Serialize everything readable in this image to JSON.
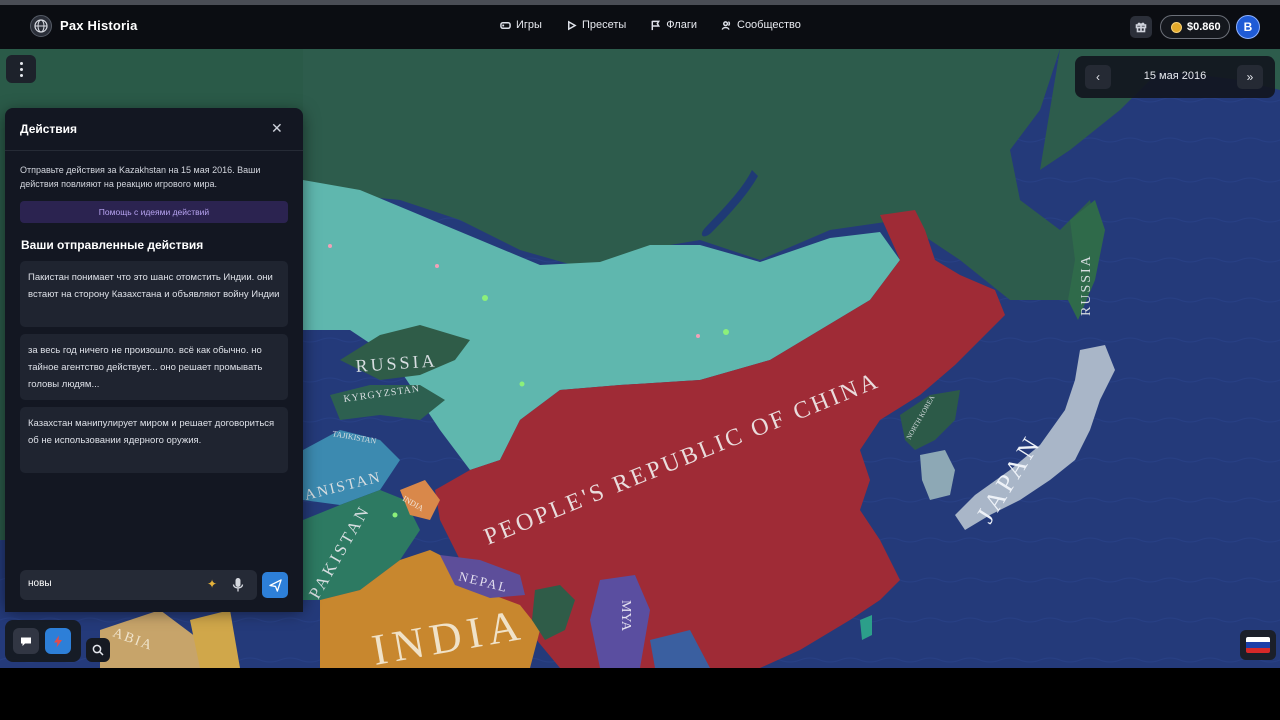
{
  "header": {
    "brand": "Pax Historia",
    "nav": [
      {
        "label": "Игры",
        "icon": "gamepad-icon"
      },
      {
        "label": "Пресеты",
        "icon": "play-icon"
      },
      {
        "label": "Флаги",
        "icon": "flag-icon"
      },
      {
        "label": "Сообщество",
        "icon": "users-icon"
      }
    ],
    "balance": "$0.860",
    "avatar_letter": "B"
  },
  "date_widget": {
    "date": "15 мая 2016",
    "prev_icon": "chevron-left-icon",
    "next_icon": "double-chevron-right-icon"
  },
  "actions_panel": {
    "title": "Действия",
    "close_label": "✕",
    "description": "Отправьте действия за Kazakhstan на 15 мая 2016. Ваши действия повлияют на реакцию игрового мира.",
    "help_button": "Помощь с идеями действий",
    "sent_title": "Ваши отправленные действия",
    "actions": [
      "Пакистан понимает что это шанс отомстить Индии. они встают на сторону Казахстана и объявляют войну Индии",
      "за весь год ничего не произошло. всё как обычно. но тайное агентство действует... оно решает промывать головы людям...",
      "Казахстан манипулирует миром и решает договориться об не использовании ядерного оружия."
    ],
    "input_value": "новы"
  },
  "map": {
    "labels": {
      "china": "PEOPLE'S REPUBLIC OF CHINA",
      "russia_west": "RUSSIA",
      "russia_east": "RUSSIA",
      "kyrgyzstan": "KYRGYZSTAN",
      "tajikistan": "TAJIKISTAN",
      "nepal": "NEPAL",
      "india": "INDIA",
      "japan": "JAPAN",
      "north_korea": "NORTH KOREA",
      "pakistan": "PAKISTAN",
      "afghanistan": "ANISTAN",
      "kashmir": "INDIA",
      "myanmar": "MYA",
      "arabia": "ABIA"
    },
    "colors": {
      "ocean": "#243a7a",
      "kazakhstan": "#5fb8b0",
      "china": "#9e2a35",
      "russia": "#2c5a48",
      "india": "#c8872e",
      "japan": "#a9b6c8",
      "nepal": "#5d4e9a"
    }
  },
  "flag": {
    "colors": [
      "#ffffff",
      "#1c3fa8",
      "#d62828"
    ]
  }
}
